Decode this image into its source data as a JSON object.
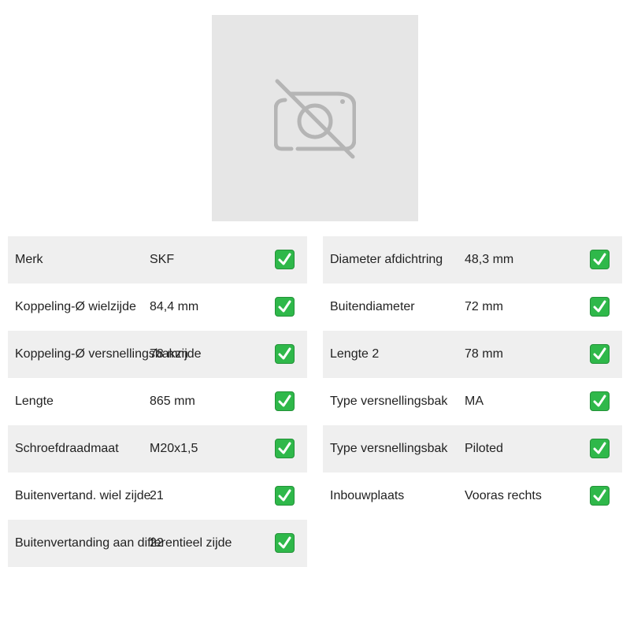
{
  "image_placeholder": {
    "icon": "no-camera-icon",
    "bg_color": "#e6e6e6",
    "icon_color": "#b5b5b5"
  },
  "check_icon": {
    "name": "check-mark-icon",
    "color": "#2fb84a"
  },
  "specs_left": [
    {
      "label": "Merk",
      "value": "SKF"
    },
    {
      "label": "Koppeling-Ø wielzijde",
      "value": "84,4 mm"
    },
    {
      "label": "Koppeling-Ø versnellingsbakzijde",
      "value": "78 mm"
    },
    {
      "label": "Lengte",
      "value": "865 mm"
    },
    {
      "label": "Schroefdraadmaat",
      "value": "M20x1,5"
    },
    {
      "label": "Buitenvertand. wiel zijde",
      "value": "21"
    },
    {
      "label": "Buitenvertanding aan differentieel zijde",
      "value": "22"
    }
  ],
  "specs_right": [
    {
      "label": "Diameter afdichtring",
      "value": "48,3 mm"
    },
    {
      "label": "Buitendiameter",
      "value": "72 mm"
    },
    {
      "label": "Lengte 2",
      "value": "78 mm"
    },
    {
      "label": "Type versnellingsbak",
      "value": "MA"
    },
    {
      "label": "Type versnellingsbak",
      "value": "Piloted"
    },
    {
      "label": "Inbouwplaats",
      "value": "Vooras rechts"
    }
  ]
}
